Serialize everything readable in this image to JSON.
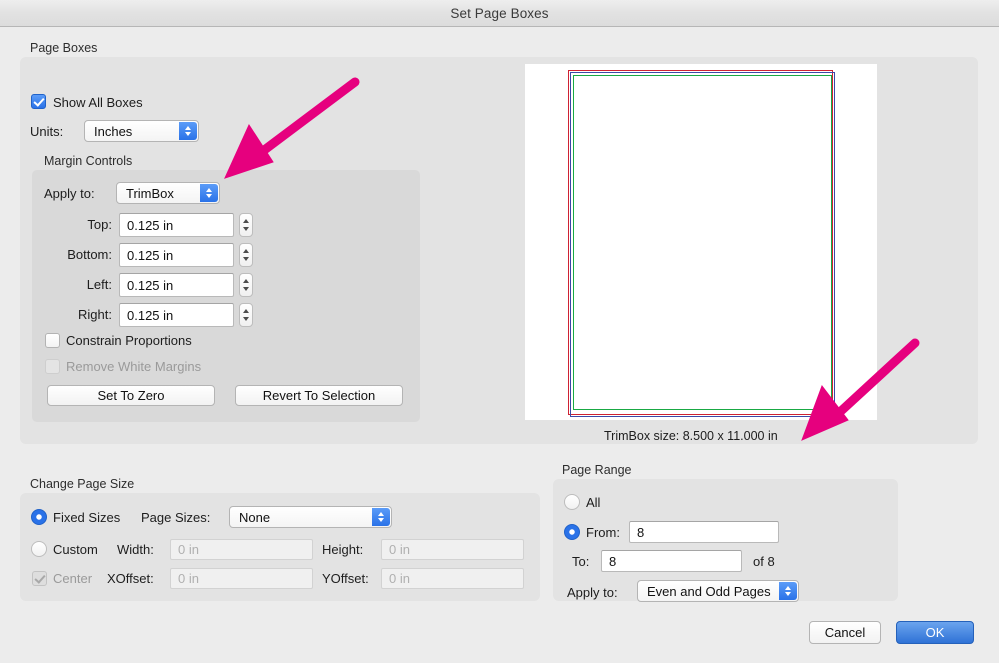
{
  "window": {
    "title": "Set Page Boxes"
  },
  "page_boxes": {
    "group_label": "Page Boxes",
    "show_all_boxes": {
      "label": "Show All Boxes",
      "checked": true
    },
    "units": {
      "label": "Units:",
      "value": "Inches"
    },
    "margin_controls": {
      "group_label": "Margin Controls",
      "apply_to": {
        "label": "Apply to:",
        "value": "TrimBox"
      },
      "fields": [
        {
          "label": "Top:",
          "value": "0.125 in"
        },
        {
          "label": "Bottom:",
          "value": "0.125 in"
        },
        {
          "label": "Left:",
          "value": "0.125 in"
        },
        {
          "label": "Right:",
          "value": "0.125 in"
        }
      ],
      "constrain_proportions": {
        "label": "Constrain Proportions",
        "checked": false
      },
      "remove_white_margins": {
        "label": "Remove White Margins",
        "checked": false,
        "disabled": true
      },
      "set_to_zero_label": "Set To Zero",
      "revert_to_selection_label": "Revert To Selection"
    },
    "preview": {
      "size_caption": "TrimBox size: 8.500 x 11.000 in",
      "box_colors": {
        "media": "#cf2233",
        "bleed": "#3b49a8",
        "trim": "#19a944"
      }
    }
  },
  "change_page_size": {
    "group_label": "Change Page Size",
    "fixed_sizes": {
      "label": "Fixed Sizes",
      "selected": true
    },
    "page_sizes": {
      "label": "Page Sizes:",
      "value": "None"
    },
    "custom": {
      "label": "Custom",
      "selected": false
    },
    "width": {
      "label": "Width:",
      "placeholder": "0 in",
      "value": ""
    },
    "height": {
      "label": "Height:",
      "placeholder": "0 in",
      "value": ""
    },
    "center": {
      "label": "Center",
      "checked": true,
      "disabled": true
    },
    "xoffset": {
      "label": "XOffset:",
      "placeholder": "0 in",
      "value": ""
    },
    "yoffset": {
      "label": "YOffset:",
      "placeholder": "0 in",
      "value": ""
    }
  },
  "page_range": {
    "group_label": "Page Range",
    "all": {
      "label": "All",
      "selected": false
    },
    "from": {
      "label": "From:",
      "value": "8",
      "selected": true
    },
    "to": {
      "label": "To:",
      "value": "8"
    },
    "of_total": "of 8",
    "apply_to": {
      "label": "Apply to:",
      "value": "Even and Odd Pages"
    }
  },
  "footer": {
    "cancel_label": "Cancel",
    "ok_label": "OK"
  },
  "annotations": {
    "accent_color": "#e6007e",
    "arrow_1_target": "apply-to-popup",
    "arrow_2_target": "trimbox-size-caption"
  }
}
